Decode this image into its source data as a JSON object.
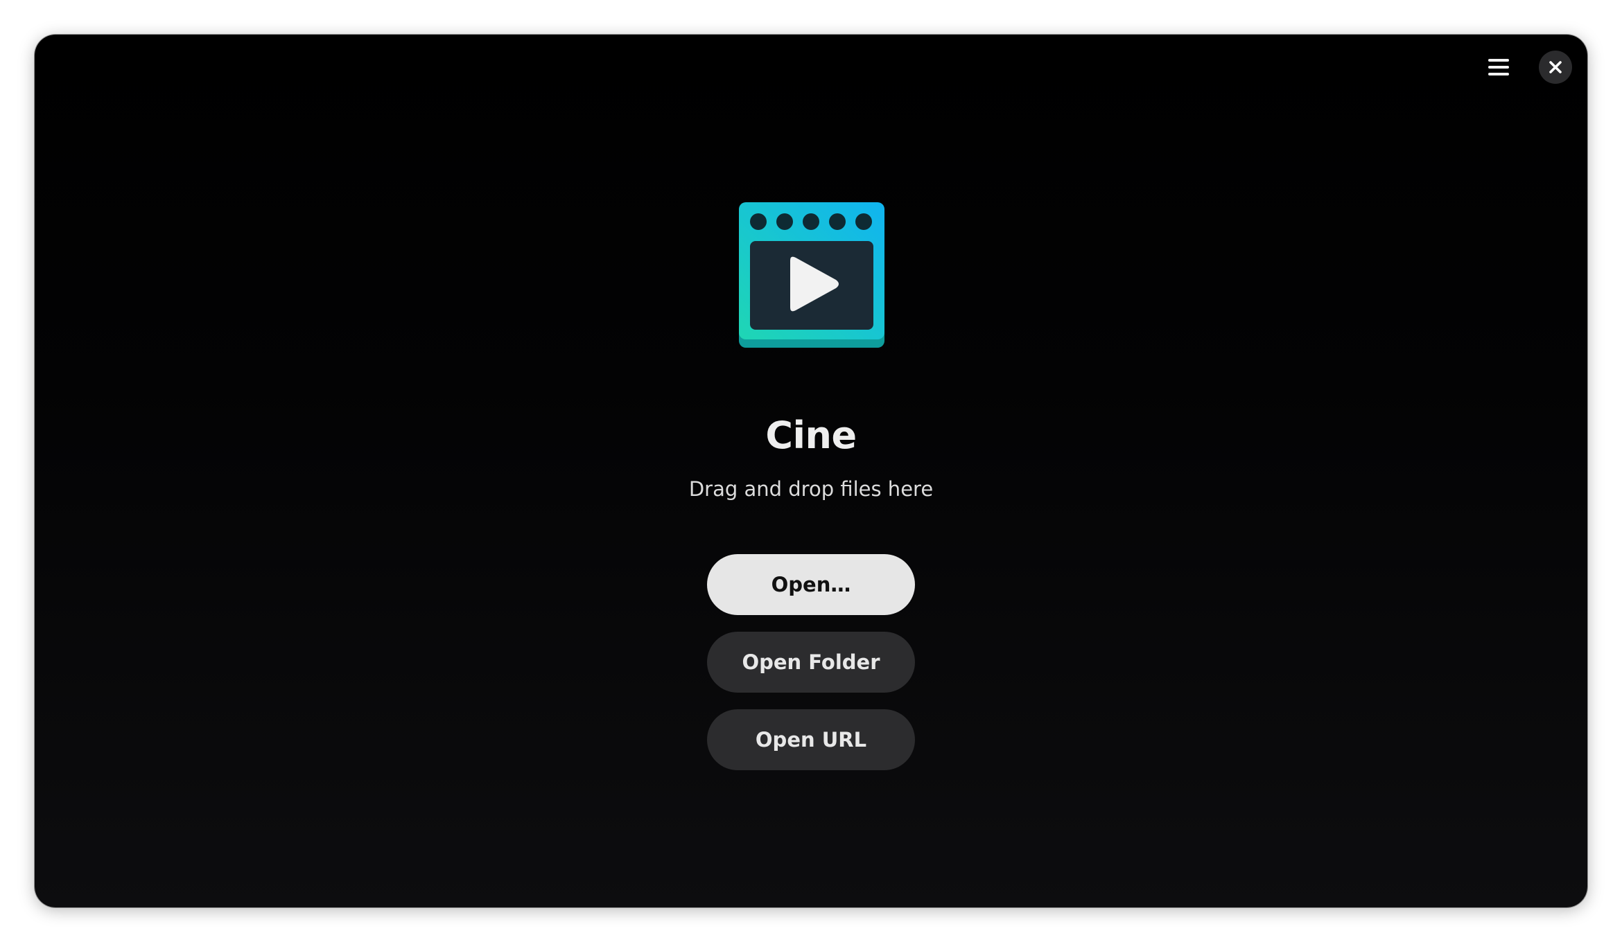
{
  "app": {
    "title": "Cine",
    "subtitle": "Drag and drop files here"
  },
  "header": {
    "menu_icon": "hamburger-menu-icon",
    "close_icon": "close-icon"
  },
  "actions": {
    "open_label": "Open…",
    "open_folder_label": "Open Folder",
    "open_url_label": "Open URL"
  },
  "colors": {
    "window_background": "#000000",
    "primary_button": "#e6e6e6",
    "secondary_button": "#2c2c2e",
    "icon_gradient_start": "#1fd6b4",
    "icon_gradient_end": "#10b4f0",
    "icon_screen": "#1b2a35"
  }
}
